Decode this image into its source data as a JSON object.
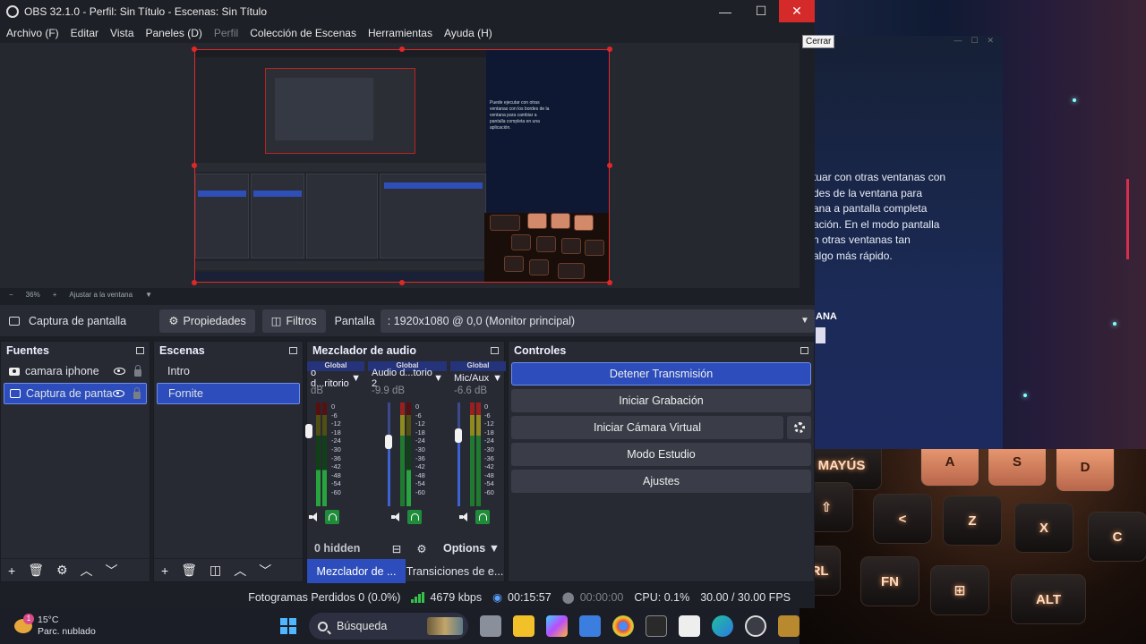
{
  "window": {
    "title": "OBS 32.1.0 - Perfil: Sin Título - Escenas: Sin Título",
    "minimize_glyph": "—",
    "maximize_glyph": "☐",
    "close_glyph": "✕",
    "close_tooltip": "Cerrar"
  },
  "menu": [
    "Archivo (F)",
    "Editar",
    "Vista",
    "Paneles (D)",
    "Perfil",
    "Colección de Escenas",
    "Herramientas",
    "Ayuda (H)"
  ],
  "preview": {
    "zoom_minus": "−",
    "zoom_value": "36%",
    "zoom_plus": "+",
    "fit_label": "Ajustar a la ventana",
    "captured_text": "Puede ejecutar con otras ventanas con los bordes de la ventana para cambiar a pantalla completa en una aplicación.",
    "keyboard_keys": [
      "MAYÚS",
      "A",
      "S",
      "D"
    ]
  },
  "source_toolbar": {
    "source_name": "Captura de pantalla",
    "properties_label": "Propiedades",
    "filters_label": "Filtros",
    "display_label": "Pantalla",
    "display_value": ": 1920x1080 @ 0,0 (Monitor principal)"
  },
  "sources": {
    "title": "Fuentes",
    "items": [
      {
        "label": "camara iphone",
        "selected": false,
        "icon": "camera-icon"
      },
      {
        "label": "Captura de pantalla",
        "selected": true,
        "icon": "monitor-icon"
      }
    ]
  },
  "scenes": {
    "title": "Escenas",
    "items": [
      {
        "label": "Intro",
        "selected": false
      },
      {
        "label": "Fornite",
        "selected": true
      }
    ]
  },
  "mixer": {
    "title": "Mezclador de audio",
    "channels": [
      {
        "badge": "Global",
        "name": "o d...ritorio",
        "db": "dB",
        "fader": 0.0
      },
      {
        "badge": "Global",
        "name": "Audio d...torio 2",
        "db": "-9.9 dB",
        "fader": 0.62
      },
      {
        "badge": "Global",
        "name": "Mic/Aux",
        "db": "-6.6 dB",
        "fader": 0.68
      }
    ],
    "scale": [
      "0",
      "-6",
      "-12",
      "-18",
      "-24",
      "-30",
      "-36",
      "-42",
      "-48",
      "-54",
      "-60"
    ],
    "hidden_label": "0 hidden",
    "options_label": "Options",
    "tabs": [
      "Mezclador de ...",
      "Transiciones de e..."
    ]
  },
  "controls": {
    "title": "Controles",
    "buttons": [
      "Detener Transmisión",
      "Iniciar Grabación",
      "Iniciar Cámara Virtual",
      "Modo Estudio",
      "Ajustes"
    ]
  },
  "status": {
    "dropped_frames": "Fotogramas Perdidos 0 (0.0%)",
    "bitrate": "4679 kbps",
    "stream_time": "00:15:57",
    "record_time": "00:00:00",
    "cpu": "CPU: 0.1%",
    "fps": "30.00 / 30.00 FPS"
  },
  "background_window": {
    "text": "tuar con otras ventanas con\ndes de la ventana para\nana a pantalla completa\nación. En el modo pantalla\nn otras ventanas tan\n algo más rápido.",
    "bold_fragment": "ANA"
  },
  "keyboard": {
    "keys": [
      "MAYÚS",
      "A",
      "S",
      "D",
      "<",
      "Z",
      "X",
      "C",
      "TRL",
      "FN",
      "ALT"
    ]
  },
  "taskbar": {
    "temperature": "15°C",
    "weather": "Parc. nublado",
    "weather_badge": "1",
    "search_placeholder": "Búsqueda"
  }
}
